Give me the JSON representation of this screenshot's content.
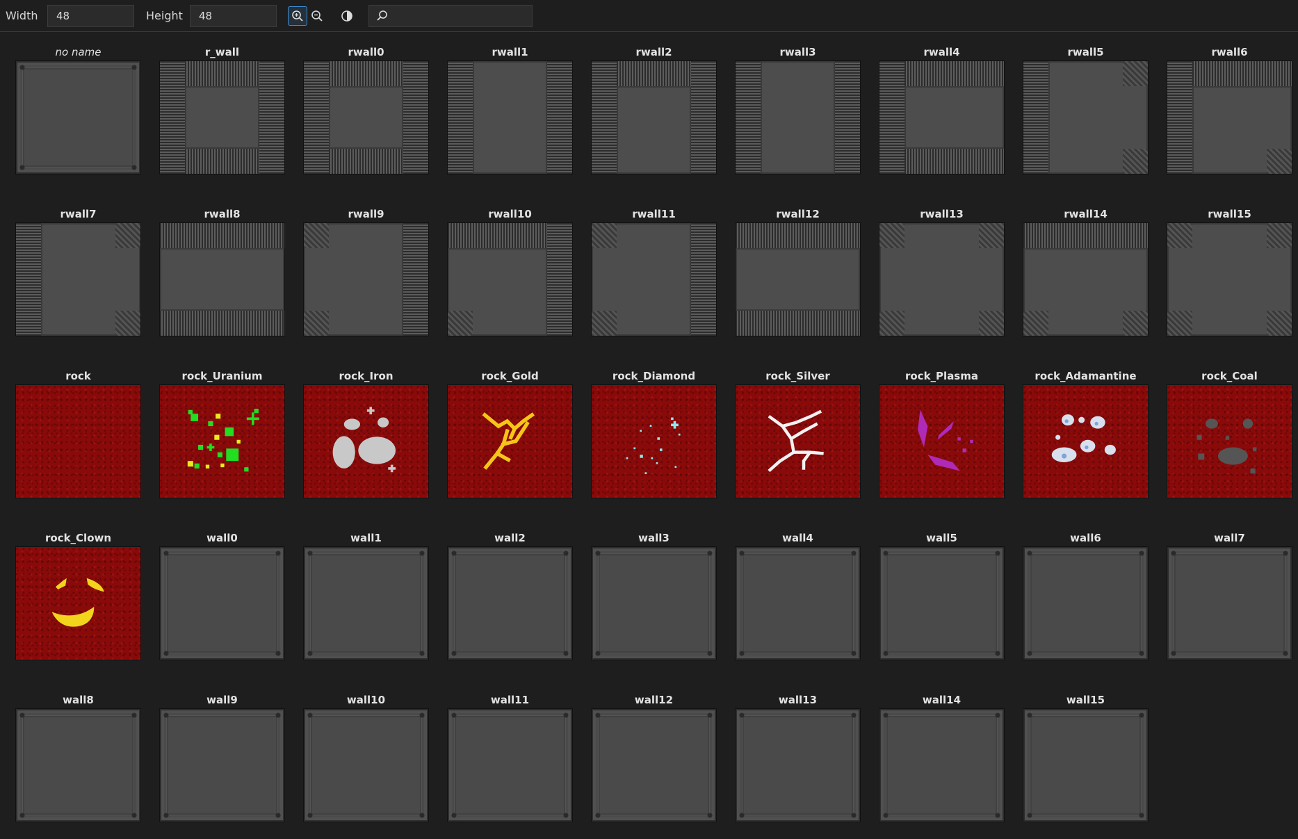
{
  "toolbar": {
    "width_label": "Width",
    "width_value": "48",
    "height_label": "Height",
    "height_value": "48",
    "search_placeholder": "",
    "icons": [
      "zoom-in-icon",
      "zoom-out-icon",
      "contrast-icon",
      "search-icon"
    ],
    "accent": "#3b8fd6"
  },
  "sprites": [
    {
      "name": "no name",
      "kind": "wall-plain",
      "italic": true
    },
    {
      "name": "r_wall",
      "kind": "rwall"
    },
    {
      "name": "rwall0",
      "kind": "rwall"
    },
    {
      "name": "rwall1",
      "kind": "rwall"
    },
    {
      "name": "rwall2",
      "kind": "rwall"
    },
    {
      "name": "rwall3",
      "kind": "rwall"
    },
    {
      "name": "rwall4",
      "kind": "rwall"
    },
    {
      "name": "rwall5",
      "kind": "rwall"
    },
    {
      "name": "rwall6",
      "kind": "rwall"
    },
    {
      "name": "rwall7",
      "kind": "rwall"
    },
    {
      "name": "rwall8",
      "kind": "rwall"
    },
    {
      "name": "rwall9",
      "kind": "rwall"
    },
    {
      "name": "rwall10",
      "kind": "rwall"
    },
    {
      "name": "rwall11",
      "kind": "rwall"
    },
    {
      "name": "rwall12",
      "kind": "rwall"
    },
    {
      "name": "rwall13",
      "kind": "rwall"
    },
    {
      "name": "rwall14",
      "kind": "rwall"
    },
    {
      "name": "rwall15",
      "kind": "rwall"
    },
    {
      "name": "rock",
      "kind": "rock"
    },
    {
      "name": "rock_Uranium",
      "kind": "rock",
      "ore": "uranium",
      "ore_color": "#22dd22"
    },
    {
      "name": "rock_Iron",
      "kind": "rock",
      "ore": "iron",
      "ore_color": "#c8c8c8"
    },
    {
      "name": "rock_Gold",
      "kind": "rock",
      "ore": "gold",
      "ore_color": "#f5c518"
    },
    {
      "name": "rock_Diamond",
      "kind": "rock",
      "ore": "diamond",
      "ore_color": "#8ee8f0"
    },
    {
      "name": "rock_Silver",
      "kind": "rock",
      "ore": "silver",
      "ore_color": "#f2f2f2"
    },
    {
      "name": "rock_Plasma",
      "kind": "rock",
      "ore": "plasma",
      "ore_color": "#b02ab8"
    },
    {
      "name": "rock_Adamantine",
      "kind": "rock",
      "ore": "adamantine",
      "ore_color": "#d8e0ee"
    },
    {
      "name": "rock_Coal",
      "kind": "rock",
      "ore": "coal",
      "ore_color": "#555555"
    },
    {
      "name": "rock_Clown",
      "kind": "rock",
      "ore": "clown",
      "ore_color": "#f2d41c"
    },
    {
      "name": "wall0",
      "kind": "wall"
    },
    {
      "name": "wall1",
      "kind": "wall"
    },
    {
      "name": "wall2",
      "kind": "wall"
    },
    {
      "name": "wall3",
      "kind": "wall"
    },
    {
      "name": "wall4",
      "kind": "wall"
    },
    {
      "name": "wall5",
      "kind": "wall"
    },
    {
      "name": "wall6",
      "kind": "wall"
    },
    {
      "name": "wall7",
      "kind": "wall"
    },
    {
      "name": "wall8",
      "kind": "wall"
    },
    {
      "name": "wall9",
      "kind": "wall"
    },
    {
      "name": "wall10",
      "kind": "wall"
    },
    {
      "name": "wall11",
      "kind": "wall"
    },
    {
      "name": "wall12",
      "kind": "wall"
    },
    {
      "name": "wall13",
      "kind": "wall"
    },
    {
      "name": "wall14",
      "kind": "wall"
    },
    {
      "name": "wall15",
      "kind": "wall"
    }
  ]
}
